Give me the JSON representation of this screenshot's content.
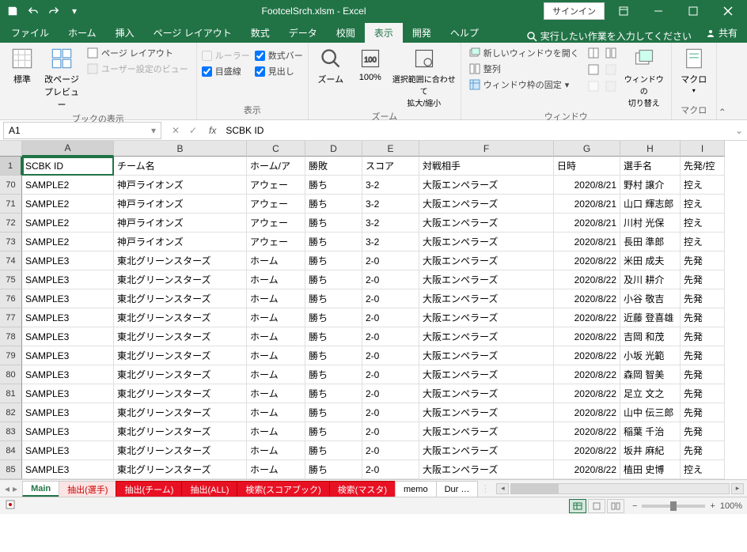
{
  "title": "FootcelSrch.xlsm - Excel",
  "signin": "サインイン",
  "tabs": [
    "ファイル",
    "ホーム",
    "挿入",
    "ページ レイアウト",
    "数式",
    "データ",
    "校閲",
    "表示",
    "開発",
    "ヘルプ"
  ],
  "active_tab": "表示",
  "tell_me": "実行したい作業を入力してください",
  "share": "共有",
  "ribbon": {
    "group1": {
      "label": "ブックの表示",
      "normal": "標準",
      "page_break": "改ページ\nプレビュー",
      "page_layout": "ページ レイアウト",
      "custom_views": "ユーザー設定のビュー"
    },
    "group2": {
      "label": "表示",
      "ruler": "ルーラー",
      "formula_bar": "数式バー",
      "gridlines": "目盛線",
      "headings": "見出し"
    },
    "group3": {
      "label": "ズーム",
      "zoom": "ズーム",
      "pct100": "100%",
      "fit": "選択範囲に合わせて\n拡大/縮小"
    },
    "group4": {
      "label": "ウィンドウ",
      "new_win": "新しいウィンドウを開く",
      "arrange": "整列",
      "freeze": "ウィンドウ枠の固定",
      "switch": "ウィンドウの\n切り替え"
    },
    "group5": {
      "label": "マクロ",
      "macro": "マクロ"
    }
  },
  "name_box": "A1",
  "formula_value": "SCBK ID",
  "columns": [
    "A",
    "B",
    "C",
    "D",
    "E",
    "F",
    "G",
    "H",
    "I"
  ],
  "headers": [
    "SCBK ID",
    "チーム名",
    "ホーム/ア",
    "勝敗",
    "スコア",
    "対戦相手",
    "日時",
    "選手名",
    "先発/控"
  ],
  "rows": [
    {
      "n": "1",
      "r": [
        "SCBK ID",
        "チーム名",
        "ホーム/ア",
        "勝敗",
        "スコア",
        "対戦相手",
        "日時",
        "選手名",
        "先発/控"
      ],
      "sel": true
    },
    {
      "n": "70",
      "r": [
        "SAMPLE2",
        "神戸ライオンズ",
        "アウェー",
        "勝ち",
        "3-2",
        "大阪エンペラーズ",
        "2020/8/21",
        "野村 譲介",
        "控え"
      ]
    },
    {
      "n": "71",
      "r": [
        "SAMPLE2",
        "神戸ライオンズ",
        "アウェー",
        "勝ち",
        "3-2",
        "大阪エンペラーズ",
        "2020/8/21",
        "山口 輝志郎",
        "控え"
      ]
    },
    {
      "n": "72",
      "r": [
        "SAMPLE2",
        "神戸ライオンズ",
        "アウェー",
        "勝ち",
        "3-2",
        "大阪エンペラーズ",
        "2020/8/21",
        "川村 光保",
        "控え"
      ]
    },
    {
      "n": "73",
      "r": [
        "SAMPLE2",
        "神戸ライオンズ",
        "アウェー",
        "勝ち",
        "3-2",
        "大阪エンペラーズ",
        "2020/8/21",
        "長田 準郎",
        "控え"
      ]
    },
    {
      "n": "74",
      "r": [
        "SAMPLE3",
        "東北グリーンスターズ",
        "ホーム",
        "勝ち",
        "2-0",
        "大阪エンペラーズ",
        "2020/8/22",
        "米田 成夫",
        "先発"
      ]
    },
    {
      "n": "75",
      "r": [
        "SAMPLE3",
        "東北グリーンスターズ",
        "ホーム",
        "勝ち",
        "2-0",
        "大阪エンペラーズ",
        "2020/8/22",
        "及川 耕介",
        "先発"
      ]
    },
    {
      "n": "76",
      "r": [
        "SAMPLE3",
        "東北グリーンスターズ",
        "ホーム",
        "勝ち",
        "2-0",
        "大阪エンペラーズ",
        "2020/8/22",
        "小谷 敬吉",
        "先発"
      ]
    },
    {
      "n": "77",
      "r": [
        "SAMPLE3",
        "東北グリーンスターズ",
        "ホーム",
        "勝ち",
        "2-0",
        "大阪エンペラーズ",
        "2020/8/22",
        "近藤 登喜雄",
        "先発"
      ]
    },
    {
      "n": "78",
      "r": [
        "SAMPLE3",
        "東北グリーンスターズ",
        "ホーム",
        "勝ち",
        "2-0",
        "大阪エンペラーズ",
        "2020/8/22",
        "吉岡 和茂",
        "先発"
      ]
    },
    {
      "n": "79",
      "r": [
        "SAMPLE3",
        "東北グリーンスターズ",
        "ホーム",
        "勝ち",
        "2-0",
        "大阪エンペラーズ",
        "2020/8/22",
        "小坂 光範",
        "先発"
      ]
    },
    {
      "n": "80",
      "r": [
        "SAMPLE3",
        "東北グリーンスターズ",
        "ホーム",
        "勝ち",
        "2-0",
        "大阪エンペラーズ",
        "2020/8/22",
        "森岡 智美",
        "先発"
      ]
    },
    {
      "n": "81",
      "r": [
        "SAMPLE3",
        "東北グリーンスターズ",
        "ホーム",
        "勝ち",
        "2-0",
        "大阪エンペラーズ",
        "2020/8/22",
        "足立 文之",
        "先発"
      ]
    },
    {
      "n": "82",
      "r": [
        "SAMPLE3",
        "東北グリーンスターズ",
        "ホーム",
        "勝ち",
        "2-0",
        "大阪エンペラーズ",
        "2020/8/22",
        "山中 伝三郎",
        "先発"
      ]
    },
    {
      "n": "83",
      "r": [
        "SAMPLE3",
        "東北グリーンスターズ",
        "ホーム",
        "勝ち",
        "2-0",
        "大阪エンペラーズ",
        "2020/8/22",
        "稲葉 千治",
        "先発"
      ]
    },
    {
      "n": "84",
      "r": [
        "SAMPLE3",
        "東北グリーンスターズ",
        "ホーム",
        "勝ち",
        "2-0",
        "大阪エンペラーズ",
        "2020/8/22",
        "坂井 麻紀",
        "先発"
      ]
    },
    {
      "n": "85",
      "r": [
        "SAMPLE3",
        "東北グリーンスターズ",
        "ホーム",
        "勝ち",
        "2-0",
        "大阪エンペラーズ",
        "2020/8/22",
        "植田 史博",
        "控え"
      ]
    }
  ],
  "sheets": [
    {
      "name": "Main",
      "cls": "active"
    },
    {
      "name": "抽出(選手)",
      "cls": "pink"
    },
    {
      "name": "抽出(チーム)",
      "cls": "red"
    },
    {
      "name": "抽出(ALL)",
      "cls": "red"
    },
    {
      "name": "検索(スコアブック)",
      "cls": "red"
    },
    {
      "name": "検索(マスタ)",
      "cls": "red"
    },
    {
      "name": "memo",
      "cls": ""
    },
    {
      "name": "Dur …",
      "cls": ""
    }
  ],
  "zoom": "100%"
}
